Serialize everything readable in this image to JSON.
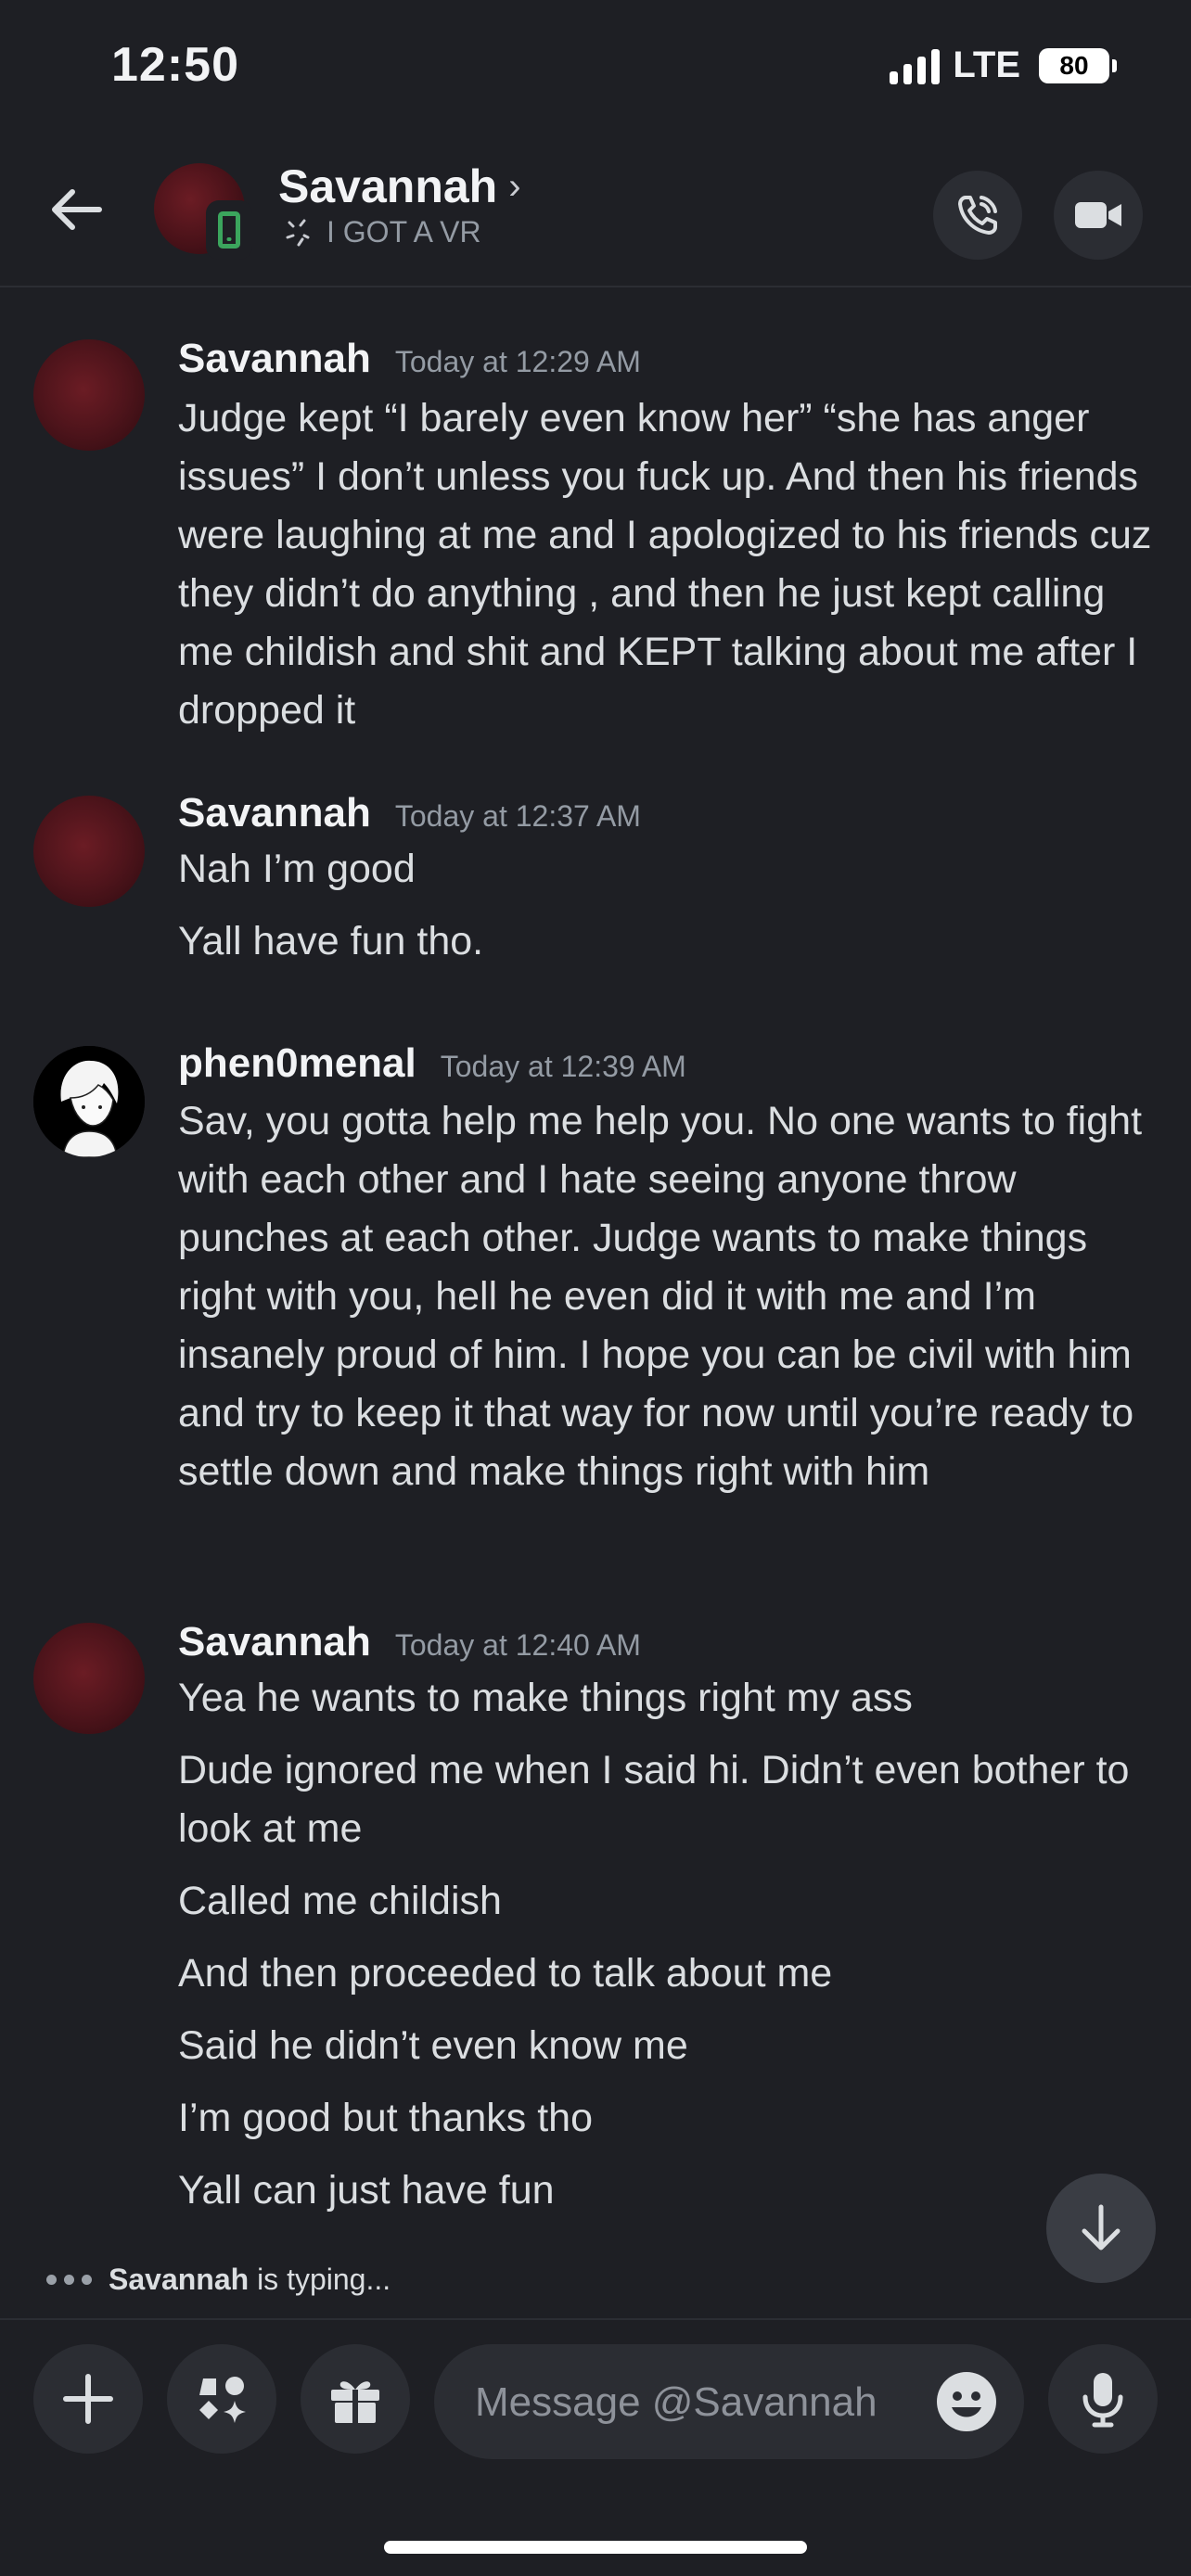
{
  "status_bar": {
    "time": "12:50",
    "network": "LTE",
    "battery": "80"
  },
  "header": {
    "contact_name": "Savannah",
    "contact_status": "I GOT A VR"
  },
  "messages": [
    {
      "author": "Savannah",
      "timestamp": "Today at 12:29 AM",
      "lines": [
        "Judge kept “I barely even know her” “she has anger issues” I don’t unless you fuck up. And then his friends were laughing at me and I apologized to his friends cuz they didn’t do anything , and then he just kept calling me childish and shit and KEPT talking about me after I dropped it"
      ]
    },
    {
      "author": "Savannah",
      "timestamp": "Today at 12:37 AM",
      "lines": [
        "Nah I’m good",
        "Yall have fun tho."
      ]
    },
    {
      "author": "phen0menal",
      "timestamp": "Today at 12:39 AM",
      "lines": [
        "Sav, you gotta help me help you. No one wants to fight with each other and I hate seeing anyone throw punches at each other. Judge wants to make things right with you, hell he even did it with me and I’m insanely proud of him. I hope you can be civil with him and try to keep it that way for now until you’re ready to settle down and make things right with him"
      ]
    },
    {
      "author": "Savannah",
      "timestamp": "Today at 12:40 AM",
      "lines": [
        "Yea he wants to make things right my ass",
        "Dude ignored me when I said hi. Didn’t even bother to look at me",
        "Called me childish",
        "And then proceeded to talk about me",
        "Said he didn’t even know me",
        "I’m good but thanks tho",
        "Yall can just have fun"
      ]
    }
  ],
  "typing_indicator": {
    "user": "Savannah",
    "suffix": "is typing..."
  },
  "composer": {
    "placeholder": "Message @Savannah"
  }
}
